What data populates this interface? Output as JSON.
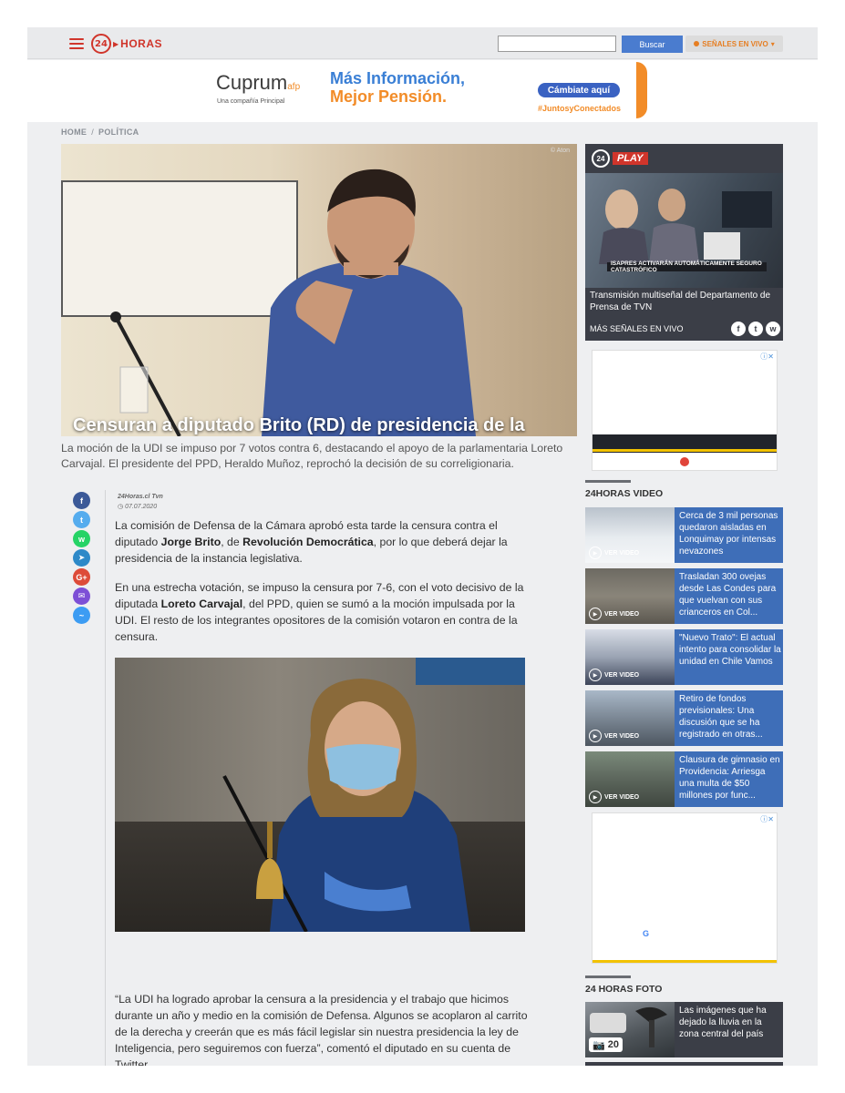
{
  "header": {
    "logo_number": "24",
    "logo_text": "HORAS",
    "search_placeholder": "",
    "search_button": "Buscar",
    "live_button": "SEÑALES EN VIVO"
  },
  "ad_banner": {
    "brand": "Cuprum",
    "brand_suffix": "afp",
    "brand_sub": "Una compañía Principal",
    "headline_1": "Más Información,",
    "headline_2": "Mejor Pensión.",
    "cta": "Cámbiate aquí",
    "hashtag": "#JuntosyConectados"
  },
  "breadcrumb": {
    "home": "HOME",
    "separator": "/",
    "section": "POLÍTICA"
  },
  "article": {
    "photo_credit": "© Aton",
    "title": "Censuran a diputado Brito (RD) de presidencia de la",
    "lead": "La moción de la UDI se impuso por 7 votos contra 6, destacando el apoyo de la parlamentaria Loreto Carvajal. El presidente del PPD, Heraldo Muñoz, reprochó la decisión de su correligionaria.",
    "byline": "24Horas.cl Tvn",
    "date": "07.07.2020",
    "p1_a": "La comisión de Defensa de la Cámara aprobó esta tarde la censura contra el diputado ",
    "p1_b": "Jorge Brito",
    "p1_c": ", de ",
    "p1_d": "Revolución Democrática",
    "p1_e": ", por lo que deberá dejar la presidencia de la instancia legislativa.",
    "p2_a": "En una estrecha votación, se impuso la censura por 7-6, con el voto decisivo de la diputada ",
    "p2_b": "Loreto Carvajal",
    "p2_c": ", del PPD, quien se sumó a la moción impulsada por la UDI. El resto de los integrantes opositores de la comisión votaron en contra de la censura.",
    "p3": "“La UDI ha logrado aprobar la censura a la presidencia y el trabajo que hicimos durante un año y medio en la comisión de Defensa. Algunos se acoplaron al carrito de la derecha y creerán que es más fácil legislar sin nuestra presidencia la ley de Inteligencia, pero seguiremos con fuerza”, comentó el diputado en su cuenta de Twitter."
  },
  "share_icons": [
    {
      "name": "facebook-icon",
      "glyph": "f",
      "color": "#3b5998"
    },
    {
      "name": "twitter-icon",
      "glyph": "t",
      "color": "#55acee"
    },
    {
      "name": "whatsapp-icon",
      "glyph": "w",
      "color": "#25d366"
    },
    {
      "name": "telegram-icon",
      "glyph": "➤",
      "color": "#2d89c8"
    },
    {
      "name": "google-plus-icon",
      "glyph": "G+",
      "color": "#dd4b39"
    },
    {
      "name": "email-icon",
      "glyph": "✉",
      "color": "#7d4fd6"
    },
    {
      "name": "messenger-icon",
      "glyph": "~",
      "color": "#3c9cf3"
    }
  ],
  "play": {
    "logo_number": "24",
    "logo_text": "PLAY",
    "ticker": "ISAPRES ACTIVARÁN AUTOMÁTICAMENTE SEGURO CATASTRÓFICO",
    "description": "Transmisión multiseñal del Departamento de Prensa de TVN",
    "more": "MÁS SEÑALES EN VIVO"
  },
  "video_section": {
    "title": "24HORAS VIDEO",
    "play_label": "VER VIDEO",
    "items": [
      {
        "title": "Cerca de 3 mil personas quedaron aisladas en Lonquimay por intensas nevazones"
      },
      {
        "title": "Trasladan 300 ovejas desde Las Condes para que vuelvan con sus crianceros en Col..."
      },
      {
        "title": "\"Nuevo Trato\": El actual intento para consolidar la unidad en Chile Vamos"
      },
      {
        "title": "Retiro de fondos previsionales: Una discusión que se ha registrado en otras..."
      },
      {
        "title": "Clausura de gimnasio en Providencia: Arriesga una multa de $50 millones por func..."
      }
    ]
  },
  "photo_section": {
    "title": "24 HORAS FOTO",
    "item_title": "Las imágenes que ha dejado la lluvia en la zona central del país",
    "count": "20"
  },
  "colors": {
    "brand_red": "#d0352b",
    "accent_blue": "#3e6eb8",
    "dark_panel": "#3b3e47"
  }
}
